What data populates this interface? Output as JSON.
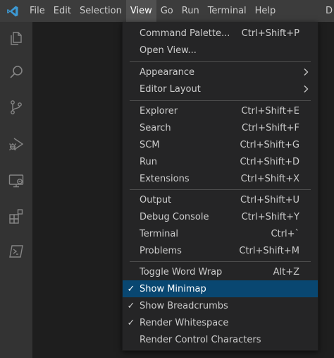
{
  "menubar": {
    "items": [
      {
        "label": "File"
      },
      {
        "label": "Edit"
      },
      {
        "label": "Selection"
      },
      {
        "label": "View"
      },
      {
        "label": "Go"
      },
      {
        "label": "Run"
      },
      {
        "label": "Terminal"
      },
      {
        "label": "Help"
      }
    ],
    "active": "View",
    "title_truncated": "D"
  },
  "activity_bar": {
    "icons": [
      "explorer-icon",
      "search-icon",
      "source-control-icon",
      "run-debug-icon",
      "remote-explorer-icon",
      "extensions-icon",
      "terminal-panel-icon"
    ]
  },
  "view_menu": {
    "items": [
      {
        "label": "Command Palette...",
        "shortcut": "Ctrl+Shift+P"
      },
      {
        "label": "Open View...",
        "shortcut": ""
      },
      {
        "label": "Appearance",
        "shortcut": "",
        "submenu": true
      },
      {
        "label": "Editor Layout",
        "shortcut": "",
        "submenu": true
      },
      {
        "label": "Explorer",
        "shortcut": "Ctrl+Shift+E"
      },
      {
        "label": "Search",
        "shortcut": "Ctrl+Shift+F"
      },
      {
        "label": "SCM",
        "shortcut": "Ctrl+Shift+G"
      },
      {
        "label": "Run",
        "shortcut": "Ctrl+Shift+D"
      },
      {
        "label": "Extensions",
        "shortcut": "Ctrl+Shift+X"
      },
      {
        "label": "Output",
        "shortcut": "Ctrl+Shift+U"
      },
      {
        "label": "Debug Console",
        "shortcut": "Ctrl+Shift+Y"
      },
      {
        "label": "Terminal",
        "shortcut": "Ctrl+`"
      },
      {
        "label": "Problems",
        "shortcut": "Ctrl+Shift+M"
      },
      {
        "label": "Toggle Word Wrap",
        "shortcut": "Alt+Z"
      },
      {
        "label": "Show Minimap",
        "shortcut": "",
        "checked": true,
        "highlighted": true
      },
      {
        "label": "Show Breadcrumbs",
        "shortcut": "",
        "checked": true
      },
      {
        "label": "Render Whitespace",
        "shortcut": "",
        "checked": true
      },
      {
        "label": "Render Control Characters",
        "shortcut": ""
      }
    ],
    "check_glyph": "✓"
  },
  "colors": {
    "titlebar_bg": "#3c3c3c",
    "activitybar_bg": "#333333",
    "menu_bg": "#252526",
    "highlight_bg": "#094771",
    "logo_blue": "#3c99d4"
  }
}
